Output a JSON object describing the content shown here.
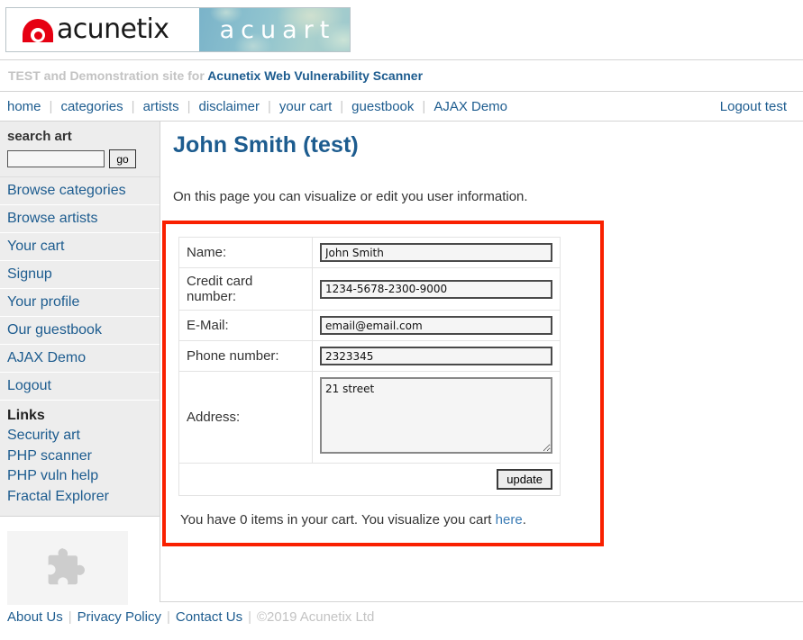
{
  "logo": {
    "brand": "acunetix",
    "site": "acuart",
    "mark_color": "#e60012"
  },
  "tagline": {
    "prefix": "TEST and Demonstration site for",
    "link": "Acunetix Web Vulnerability Scanner"
  },
  "topnav": {
    "items": [
      {
        "label": "home"
      },
      {
        "label": "categories"
      },
      {
        "label": "artists"
      },
      {
        "label": "disclaimer"
      },
      {
        "label": "your cart"
      },
      {
        "label": "guestbook"
      },
      {
        "label": "AJAX Demo"
      }
    ],
    "separator": "|",
    "logout": "Logout test"
  },
  "sidebar": {
    "search": {
      "title": "search art",
      "value": "",
      "placeholder": "",
      "go_label": "go"
    },
    "items": [
      {
        "label": "Browse categories"
      },
      {
        "label": "Browse artists"
      },
      {
        "label": "Your cart"
      },
      {
        "label": "Signup"
      },
      {
        "label": "Your profile"
      },
      {
        "label": "Our guestbook"
      },
      {
        "label": "AJAX Demo"
      },
      {
        "label": "Logout"
      }
    ],
    "links": {
      "title": "Links",
      "items": [
        {
          "label": "Security art"
        },
        {
          "label": "PHP scanner"
        },
        {
          "label": "PHP vuln help"
        },
        {
          "label": "Fractal Explorer"
        }
      ]
    },
    "plugin_placeholder_icon": "puzzle-piece-icon"
  },
  "main": {
    "title": "John Smith (test)",
    "intro": "On this page you can visualize or edit you user information.",
    "highlight_color": "#f92000",
    "form": {
      "rows": [
        {
          "label": "Name:",
          "value": "John Smith",
          "type": "text"
        },
        {
          "label": "Credit card number:",
          "value": "1234-5678-2300-9000",
          "type": "text"
        },
        {
          "label": "E-Mail:",
          "value": "email@email.com",
          "type": "text"
        },
        {
          "label": "Phone number:",
          "value": "2323345",
          "type": "text"
        },
        {
          "label": "Address:",
          "value": "21 street",
          "type": "textarea"
        }
      ],
      "submit_label": "update"
    },
    "cart_note": {
      "before": "You have 0 items in your cart. You visualize you cart ",
      "link": "here",
      "after": "."
    }
  },
  "footer": {
    "links": [
      {
        "label": "About Us"
      },
      {
        "label": "Privacy Policy"
      },
      {
        "label": "Contact Us"
      }
    ],
    "separator": "|",
    "copyright": "©2019 Acunetix Ltd"
  }
}
